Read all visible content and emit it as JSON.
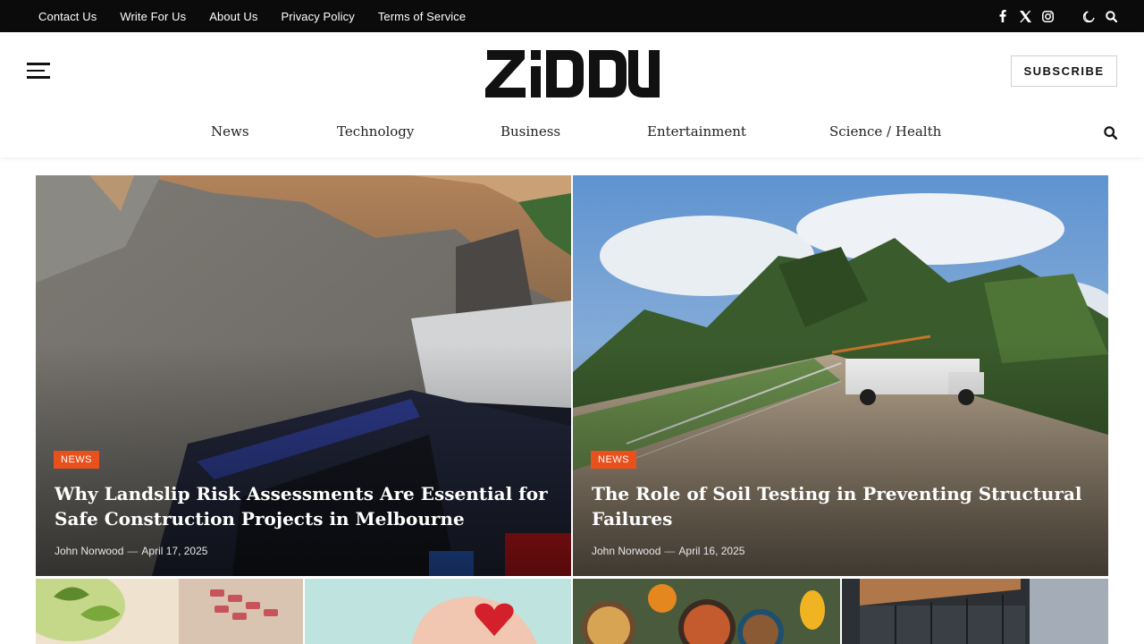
{
  "topbar": {
    "links": [
      "Contact Us",
      "Write For Us",
      "About Us",
      "Privacy Policy",
      "Terms of Service"
    ],
    "icons": [
      "facebook-icon",
      "x-icon",
      "instagram-icon",
      "moon-icon",
      "search-icon"
    ]
  },
  "header": {
    "logo_text": "ZIDDU",
    "subscribe_label": "SUBSCRIBE",
    "nav": [
      "News",
      "Technology",
      "Business",
      "Entertainment",
      "Science / Health"
    ]
  },
  "featured": [
    {
      "category": "NEWS",
      "title": "Why Landslip Risk Assessments Are Essential for Safe Construction Projects in Melbourne",
      "author": "John Norwood",
      "date": "April 17, 2025"
    },
    {
      "category": "NEWS",
      "title": "The Role of Soil Testing in Preventing Structural Failures",
      "author": "John Norwood",
      "date": "April 16, 2025"
    }
  ],
  "colors": {
    "accent": "#e8501c",
    "topbar_bg": "#0b0b0b"
  }
}
